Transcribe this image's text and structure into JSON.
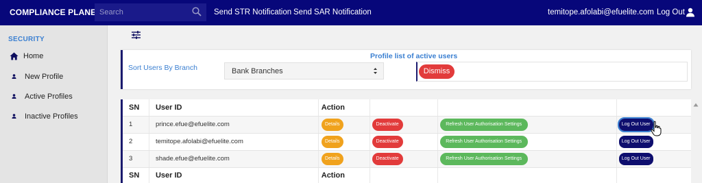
{
  "header": {
    "brand": "COMPLIANCE PLANET",
    "search_placeholder": "Search",
    "nav": [
      "Send STR Notification",
      "Send SAR Notification"
    ],
    "user_email": "temitope.afolabi@efuelite.com",
    "logout_label": "Log Out",
    "icons": [
      "search-icon",
      "user-icon"
    ]
  },
  "sidebar": {
    "section_title": "SECURITY",
    "items": [
      {
        "label": "Home",
        "icon": "home-icon"
      },
      {
        "label": "New Profile",
        "icon": "person-icon"
      },
      {
        "label": "Active Profiles",
        "icon": "person-icon"
      },
      {
        "label": "Inactive Profiles",
        "icon": "person-icon"
      }
    ]
  },
  "filter": {
    "title": "Profile list of active users",
    "sort_label": "Sort Users By Branch",
    "branch_selected": "Bank Branches",
    "dismiss_label": "Dismiss"
  },
  "table": {
    "headers": [
      "SN",
      "User ID",
      "Action"
    ],
    "footer_headers": [
      "SN",
      "User ID",
      "Action"
    ],
    "buttons": {
      "details": "Details",
      "deactivate": "Deactivate",
      "refresh": "Refresh User Authorisation Settings",
      "logout": "Log Out User"
    },
    "rows": [
      {
        "sn": "1",
        "user_id": "prince.efue@efuelite.com"
      },
      {
        "sn": "2",
        "user_id": "temitope.afolabi@efuelite.com"
      },
      {
        "sn": "3",
        "user_id": "shade.efue@efuelite.com"
      }
    ]
  },
  "colors": {
    "topbar": "#07077a",
    "accent_blue": "#3a7fd1",
    "details": "#f0a21d",
    "deactivate": "#e23b3b",
    "refresh": "#5cb85c",
    "logout": "#0e0e6e"
  }
}
